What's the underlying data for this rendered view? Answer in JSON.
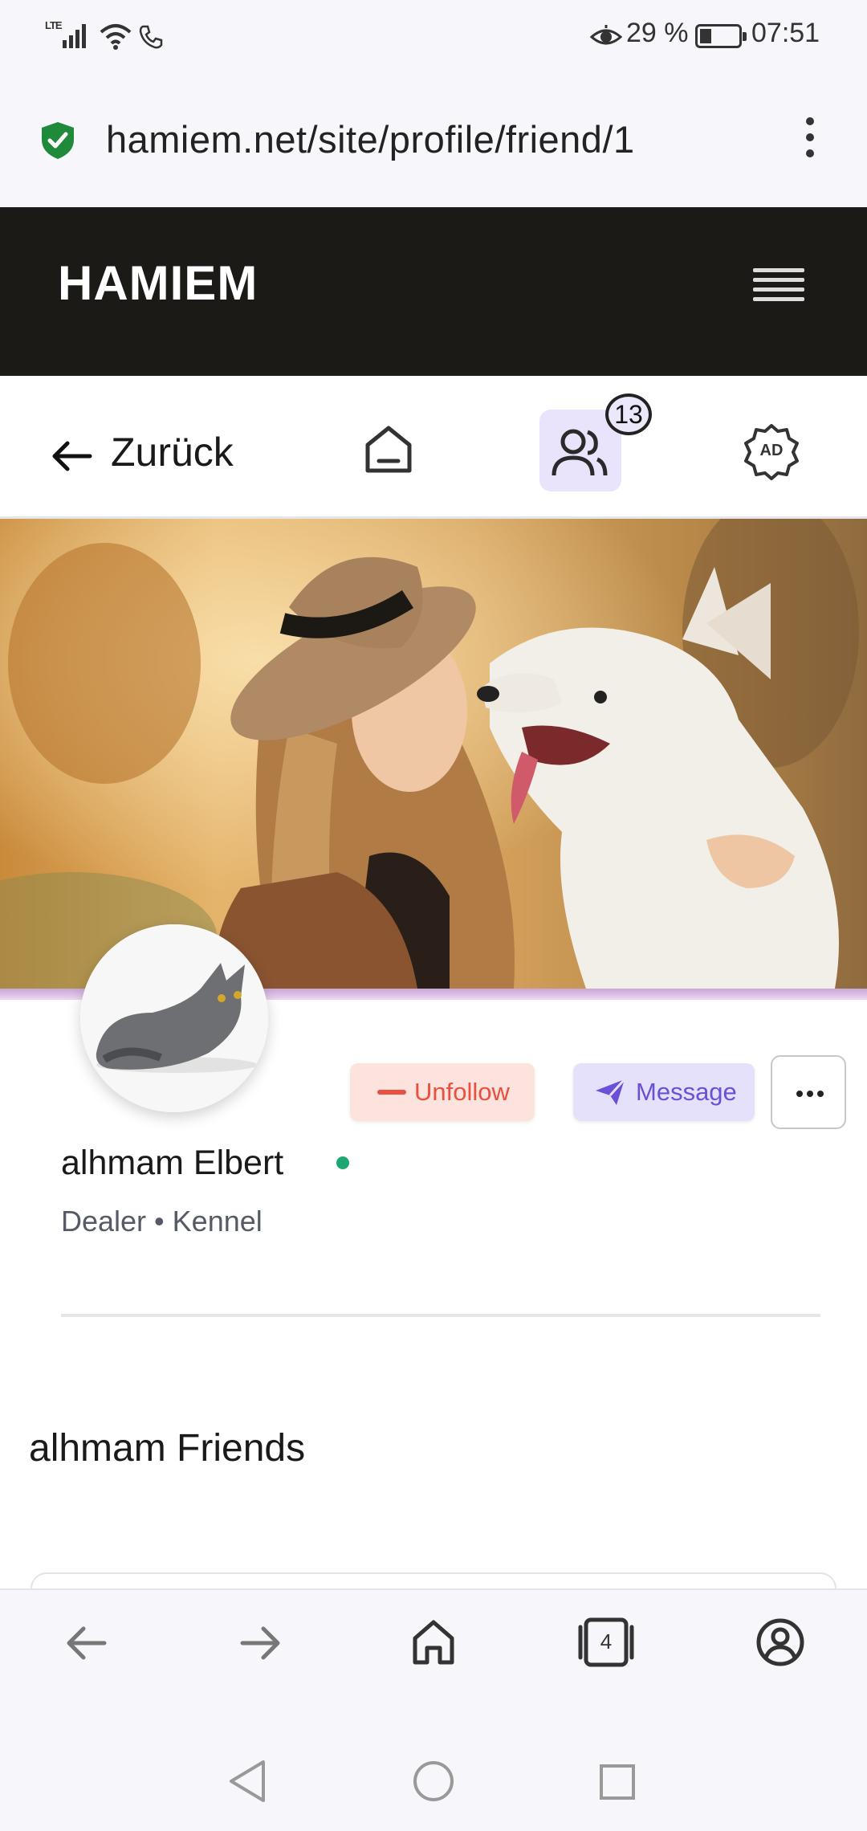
{
  "status_bar": {
    "network": "LTE",
    "battery_percent": "29 %",
    "time": "07:51"
  },
  "browser": {
    "url": "hamiem.net/site/profile/friend/1"
  },
  "site": {
    "logo": "HAMIEM"
  },
  "nav": {
    "back_label": "Zurück",
    "friends_badge": "13",
    "ad_label": "AD"
  },
  "profile": {
    "name": "alhmam Elbert",
    "subtitle": "Dealer • Kennel",
    "online": true,
    "unfollow_label": "Unfollow",
    "message_label": "Message"
  },
  "friends_section": {
    "title": "alhmam Friends"
  },
  "browser_bottom": {
    "tab_count": "4"
  },
  "colors": {
    "header_bg": "#1b1a17",
    "accent_purple": "#6b4fd6",
    "unfollow_red": "#e9503f",
    "online_green": "#1ea672",
    "shield_green": "#1f8a3a"
  },
  "icons": {
    "status": [
      "lte-signal-icon",
      "wifi-icon",
      "phone-icon",
      "eye-icon",
      "battery-icon"
    ],
    "nav": [
      "arrow-left-icon",
      "home-icon",
      "users-icon",
      "ad-badge-icon"
    ],
    "browser_bottom": [
      "back-icon",
      "forward-icon",
      "home-icon",
      "tabs-icon",
      "account-icon"
    ],
    "system": [
      "triangle-back-icon",
      "circle-home-icon",
      "square-recents-icon"
    ]
  }
}
